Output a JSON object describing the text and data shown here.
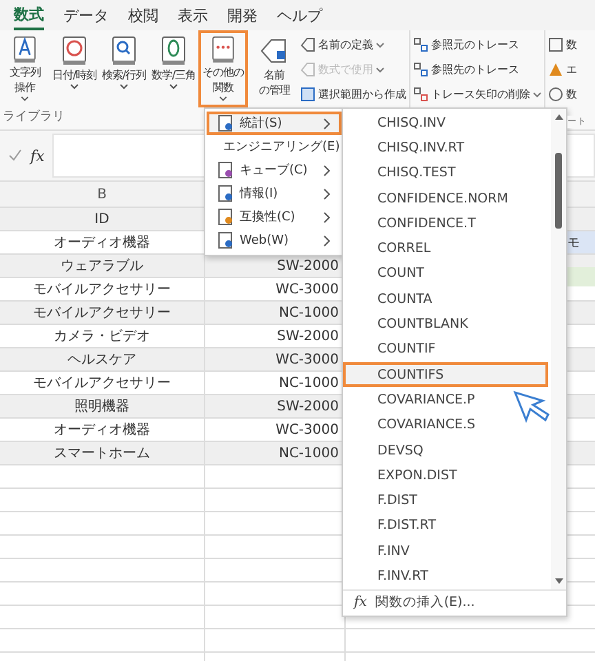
{
  "tabs": [
    {
      "label": "数式",
      "selected": true
    },
    {
      "label": "データ",
      "selected": false
    },
    {
      "label": "校閲",
      "selected": false
    },
    {
      "label": "表示",
      "selected": false
    },
    {
      "label": "開発",
      "selected": false
    },
    {
      "label": "ヘルプ",
      "selected": false
    }
  ],
  "ribbon": {
    "big_buttons": [
      {
        "kind": "text",
        "lines": [
          "文字列",
          "操作"
        ],
        "selected": false
      },
      {
        "kind": "date",
        "lines": [
          "日付/時刻"
        ],
        "selected": false
      },
      {
        "kind": "lookup",
        "lines": [
          "検索/行列"
        ],
        "selected": false
      },
      {
        "kind": "math",
        "lines": [
          "数学/三角"
        ],
        "selected": false
      },
      {
        "kind": "more",
        "lines": [
          "その他の",
          "関数"
        ],
        "selected": true
      }
    ],
    "group_label": "ライブラリ",
    "name_manager": [
      "名前",
      "の管理"
    ],
    "name_items": [
      {
        "kind": "tag",
        "label": "名前の定義",
        "disabled": false,
        "dropdown": true
      },
      {
        "kind": "use",
        "label": "数式で使用",
        "disabled": true,
        "dropdown": true
      },
      {
        "kind": "create",
        "label": "選択範囲から作成",
        "disabled": false,
        "dropdown": false
      }
    ],
    "trace_items": [
      {
        "kind": "precedents",
        "label": "参照元のトレース",
        "dropdown": false
      },
      {
        "kind": "dependents",
        "label": "参照先のトレース",
        "dropdown": false
      },
      {
        "kind": "remove",
        "label": "トレース矢印の削除",
        "dropdown": true
      }
    ],
    "cut_items": [
      {
        "kind": "show",
        "label": "数"
      },
      {
        "kind": "error",
        "label": "エ"
      },
      {
        "kind": "eval",
        "label": "数"
      }
    ],
    "cut_group_label": "ート"
  },
  "formula_bar": {
    "fx": "fx"
  },
  "sheet": {
    "column_header": "B",
    "header_cell": "ID",
    "rows": [
      {
        "b": "オーディオ機器"
      },
      {
        "b": "ウェアラブル",
        "c": "SW-2000"
      },
      {
        "b": "モバイルアクセサリー",
        "c": "WC-3000"
      },
      {
        "b": "モバイルアクセサリー",
        "c": "NC-1000"
      },
      {
        "b": "カメラ・ビデオ",
        "c": "SW-2000"
      },
      {
        "b": "ヘルスケア",
        "c": "WC-3000"
      },
      {
        "b": "モバイルアクセサリー",
        "c": "NC-1000"
      },
      {
        "b": "照明機器",
        "c": "SW-2000"
      },
      {
        "b": "オーディオ機器",
        "c": "WC-3000"
      },
      {
        "b": "スマートホーム",
        "c": "NC-1000"
      }
    ],
    "side_cell": "モ"
  },
  "category_menu": [
    {
      "kind": "stat",
      "label": "統計(S)",
      "selected": true
    },
    {
      "kind": "eng",
      "label": "エンジニアリング(E)",
      "selected": false
    },
    {
      "kind": "cube",
      "label": "キューブ(C)",
      "selected": false
    },
    {
      "kind": "info",
      "label": "情報(I)",
      "selected": false
    },
    {
      "kind": "compat",
      "label": "互換性(C)",
      "selected": false
    },
    {
      "kind": "web",
      "label": "Web(W)",
      "selected": false
    }
  ],
  "function_menu": {
    "items": [
      {
        "label": "CHISQ.INV",
        "selected": false
      },
      {
        "label": "CHISQ.INV.RT",
        "selected": false
      },
      {
        "label": "CHISQ.TEST",
        "selected": false
      },
      {
        "label": "CONFIDENCE.NORM",
        "selected": false
      },
      {
        "label": "CONFIDENCE.T",
        "selected": false
      },
      {
        "label": "CORREL",
        "selected": false
      },
      {
        "label": "COUNT",
        "selected": false
      },
      {
        "label": "COUNTA",
        "selected": false
      },
      {
        "label": "COUNTBLANK",
        "selected": false
      },
      {
        "label": "COUNTIF",
        "selected": false
      },
      {
        "label": "COUNTIFS",
        "selected": true
      },
      {
        "label": "COVARIANCE.P",
        "selected": false
      },
      {
        "label": "COVARIANCE.S",
        "selected": false
      },
      {
        "label": "DEVSQ",
        "selected": false
      },
      {
        "label": "EXPON.DIST",
        "selected": false
      },
      {
        "label": "F.DIST",
        "selected": false
      },
      {
        "label": "F.DIST.RT",
        "selected": false
      },
      {
        "label": "F.INV",
        "selected": false
      },
      {
        "label": "F.INV.RT",
        "selected": false
      }
    ],
    "footer_icon": "fx",
    "footer": "関数の挿入(E)..."
  }
}
